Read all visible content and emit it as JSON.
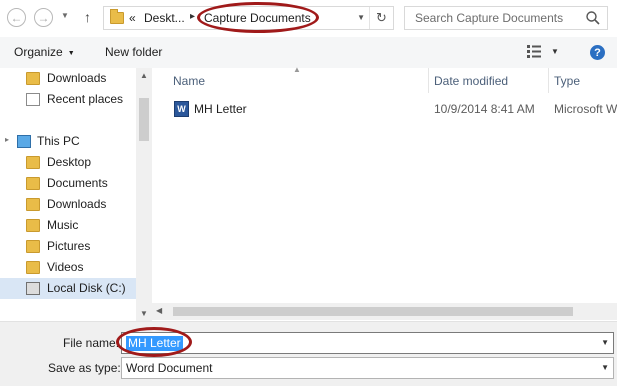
{
  "address_bar": {
    "breadcrumb_overflow": "«",
    "breadcrumb_1": "Deskt...",
    "separator": "▸",
    "breadcrumb_2": "Capture Documents"
  },
  "search": {
    "placeholder": "Search Capture Documents"
  },
  "toolbar": {
    "organize_label": "Organize",
    "new_folder_label": "New folder",
    "help_label": "?"
  },
  "nav_pane": {
    "quick_access": [
      {
        "label": "Downloads",
        "icon": "downloads-folder-icon"
      },
      {
        "label": "Recent places",
        "icon": "recent-places-icon"
      }
    ],
    "this_pc_label": "This PC",
    "this_pc_items": [
      {
        "label": "Desktop",
        "icon": "desktop-folder-icon"
      },
      {
        "label": "Documents",
        "icon": "documents-folder-icon"
      },
      {
        "label": "Downloads",
        "icon": "downloads-folder-icon"
      },
      {
        "label": "Music",
        "icon": "music-folder-icon"
      },
      {
        "label": "Pictures",
        "icon": "pictures-folder-icon"
      },
      {
        "label": "Videos",
        "icon": "videos-folder-icon"
      },
      {
        "label": "Local Disk (C:)",
        "icon": "drive-icon"
      }
    ]
  },
  "file_list": {
    "columns": {
      "name": "Name",
      "date": "Date modified",
      "type": "Type"
    },
    "rows": [
      {
        "name": "MH Letter",
        "date": "10/9/2014 8:41 AM",
        "type": "Microsoft W"
      }
    ]
  },
  "bottom": {
    "file_name_label": "File name:",
    "file_name_value": "MH Letter",
    "save_as_type_label": "Save as type:",
    "save_as_type_value": "Word Document"
  },
  "colors": {
    "highlight_circle": "#a01a1a",
    "selection": "#3399ff",
    "folder": "#e9bc48",
    "word_icon": "#2b579a"
  }
}
